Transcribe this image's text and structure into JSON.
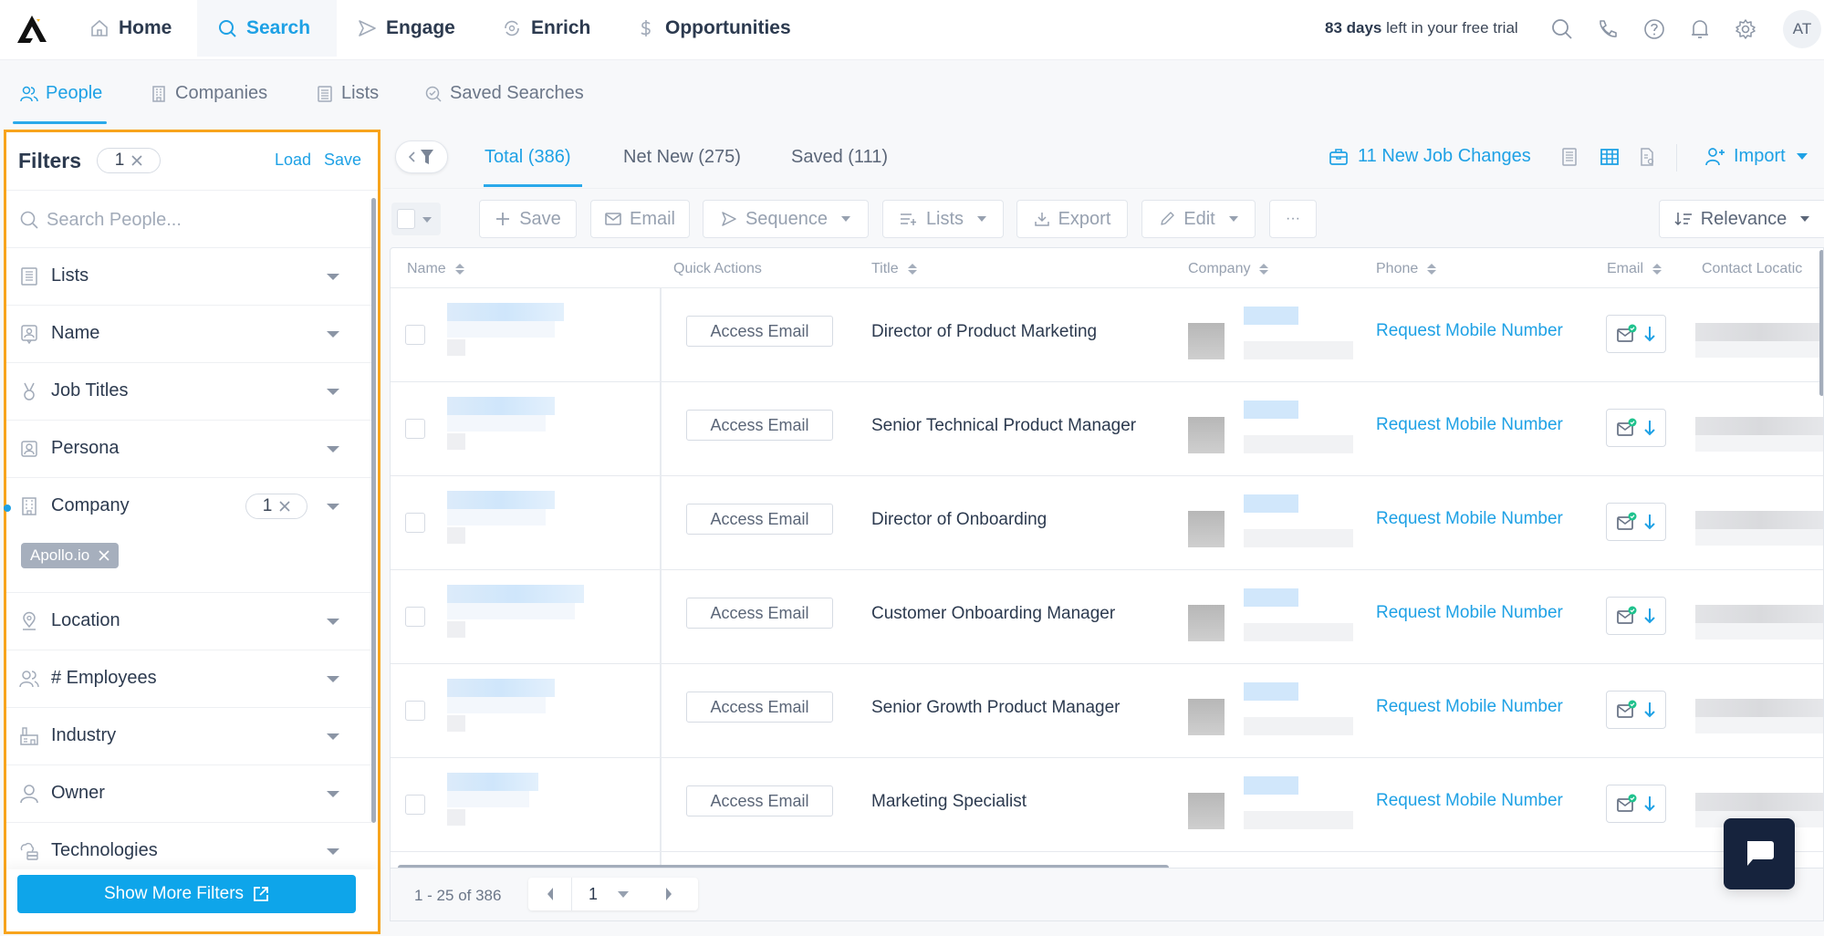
{
  "topnav": {
    "items": [
      {
        "label": "Home",
        "icon": "home-icon"
      },
      {
        "label": "Search",
        "icon": "search-icon",
        "active": true
      },
      {
        "label": "Engage",
        "icon": "send-icon"
      },
      {
        "label": "Enrich",
        "icon": "refresh-icon"
      },
      {
        "label": "Opportunities",
        "icon": "dollar-icon"
      }
    ],
    "trial_bold": "83 days",
    "trial_rest": " left in your free trial",
    "avatar_initials": "AT"
  },
  "subnav": {
    "items": [
      {
        "label": "People",
        "icon": "people-icon",
        "active": true
      },
      {
        "label": "Companies",
        "icon": "building-icon"
      },
      {
        "label": "Lists",
        "icon": "list-icon"
      },
      {
        "label": "Saved Searches",
        "icon": "saved-search-icon"
      }
    ]
  },
  "filters": {
    "title": "Filters",
    "count": "1",
    "load": "Load",
    "save": "Save",
    "search_placeholder": "Search People...",
    "items": [
      {
        "label": "Lists",
        "icon": "list-icon"
      },
      {
        "label": "Name",
        "icon": "id-badge-icon"
      },
      {
        "label": "Job Titles",
        "icon": "medal-icon"
      },
      {
        "label": "Persona",
        "icon": "persona-icon"
      },
      {
        "label": "Company",
        "icon": "building-icon",
        "count": "1",
        "active": true
      },
      {
        "label": "Location",
        "icon": "location-pin-icon"
      },
      {
        "label": "# Employees",
        "icon": "people-icon"
      },
      {
        "label": "Industry",
        "icon": "factory-icon"
      },
      {
        "label": "Owner",
        "icon": "user-icon"
      },
      {
        "label": "Technologies",
        "icon": "tech-stack-icon"
      }
    ],
    "company_tag": "Apollo.io",
    "show_more": "Show More Filters"
  },
  "results_tabs": [
    {
      "label": "Total (386)",
      "active": true
    },
    {
      "label": "Net New (275)"
    },
    {
      "label": "Saved (111)"
    }
  ],
  "job_changes": "11 New Job Changes",
  "import_label": "Import",
  "toolbar": {
    "save": "Save",
    "email": "Email",
    "sequence": "Sequence",
    "lists": "Lists",
    "export": "Export",
    "edit": "Edit",
    "more": "···",
    "sort": "Relevance"
  },
  "table": {
    "columns": [
      "Name",
      "Quick Actions",
      "Title",
      "Company",
      "Phone",
      "Email",
      "Contact Locatic"
    ],
    "rows": [
      {
        "action": "Access Email",
        "title": "Director of Product Marketing",
        "phone": "Request Mobile Number"
      },
      {
        "action": "Access Email",
        "title": "Senior Technical Product Manager",
        "phone": "Request Mobile Number"
      },
      {
        "action": "Access Email",
        "title": "Director of Onboarding",
        "phone": "Request Mobile Number"
      },
      {
        "action": "Access Email",
        "title": "Customer Onboarding Manager",
        "phone": "Request Mobile Number"
      },
      {
        "action": "Access Email",
        "title": "Senior Growth Product Manager",
        "phone": "Request Mobile Number"
      },
      {
        "action": "Access Email",
        "title": "Marketing Specialist",
        "phone": "Request Mobile Number"
      }
    ]
  },
  "pagination": {
    "range": "1 - 25 of 386",
    "page": "1"
  },
  "colors": {
    "accent": "#1ea1e5",
    "highlight_border": "#f8a41d",
    "chat_bg": "#16233d"
  }
}
